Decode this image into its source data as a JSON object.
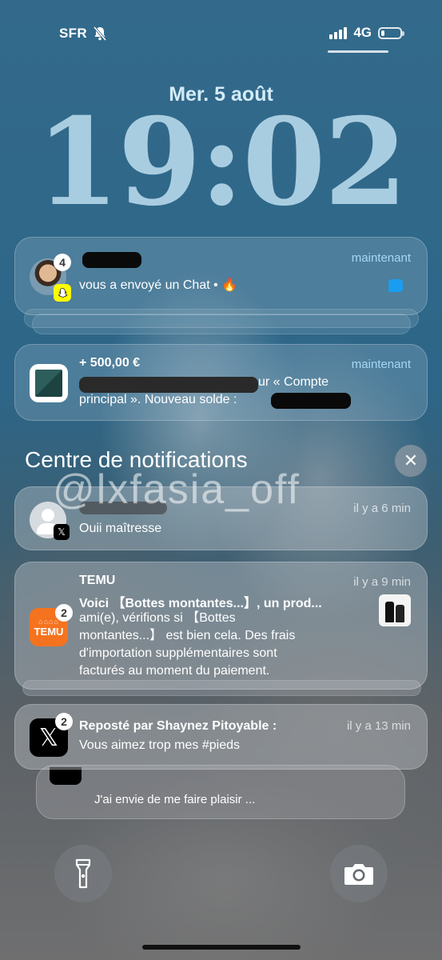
{
  "status": {
    "carrier": "SFR",
    "network": "4G",
    "battery_level": 0.2
  },
  "lock": {
    "date": "Mer. 5 août",
    "time": "19:02"
  },
  "notifications": [
    {
      "app": "snapchat",
      "badge": "4",
      "title": "",
      "body": "vous a envoyé un Chat • 🔥",
      "time": "maintenant"
    },
    {
      "app": "bank",
      "title": "+ 500,00 €",
      "body_line1": "ur « Compte",
      "body_line2": "principal ». Nouveau solde :",
      "time": "maintenant"
    }
  ],
  "notification_center": {
    "title": "Centre de notifications",
    "watermark": "@lxfasia_off",
    "items": [
      {
        "app": "x",
        "body": "Ouii maîtresse",
        "time": "il y a 6 min"
      },
      {
        "app": "temu",
        "badge": "2",
        "sender": "TEMU",
        "title": "Voici 【Bottes montantes...】, un prod...",
        "body": [
          "ami(e), vérifions si 【Bottes",
          "montantes...】 est bien cela. Des frais",
          "d'importation supplémentaires sont",
          "facturés au moment du paiement."
        ],
        "icon_text": "TEMU",
        "time": "il y a 9 min"
      },
      {
        "app": "x",
        "badge": "2",
        "title": "Reposté par Shaynez Pitoyable :",
        "body": "Vous aimez trop mes #pieds",
        "time": "il y a 13 min",
        "stacked_body": "J'ai envie de me faire plaisir ..."
      }
    ]
  },
  "colors": {
    "wallpaper": "#2f6485",
    "clock": "#a9cde0",
    "accent": "#a6d7f5",
    "temu": "#f5731f"
  },
  "icons": [
    "mute-bell-icon",
    "signal-icon",
    "battery-icon",
    "close-icon",
    "flashlight-icon",
    "camera-icon"
  ]
}
